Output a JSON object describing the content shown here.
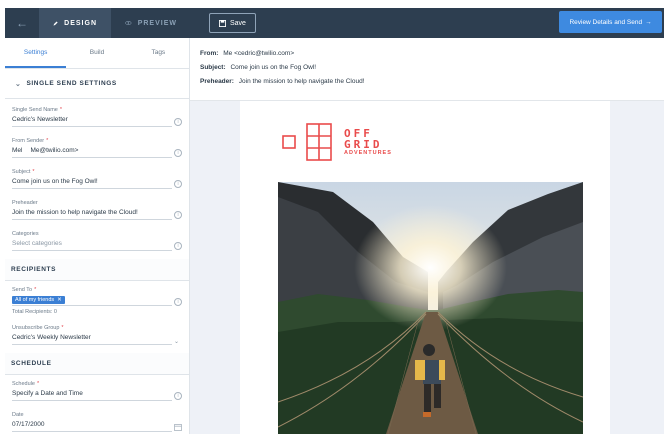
{
  "topbar": {
    "design_label": "DESIGN",
    "preview_label": "PREVIEW",
    "save_label": "Save",
    "review_label": "Review Details and Send",
    "review_arrow": "→"
  },
  "left": {
    "tabs": [
      "Settings",
      "Build",
      "Tags"
    ],
    "single_send_settings": "SINGLE SEND SETTINGS",
    "fields": {
      "name": {
        "label": "Single Send Name",
        "value": "Cedric's Newsletter"
      },
      "from": {
        "label": "From Sender",
        "value_a": "Mel",
        "value_b": "Me@twilio.com>"
      },
      "subject": {
        "label": "Subject",
        "value": "Come join us on the Fog Owl!"
      },
      "preheader": {
        "label": "Preheader",
        "value": "Join the mission to help navigate the Cloud!"
      },
      "categories": {
        "label": "Categories",
        "placeholder": "Select categories"
      }
    },
    "recipients": {
      "heading": "RECIPIENTS",
      "send_to_label": "Send To",
      "chip": "All of my friends",
      "total": "Total Recipients: 0",
      "unsub_label": "Unsubscribe Group",
      "unsub_value": "Cedric's Weekly Newsletter"
    },
    "schedule": {
      "heading": "SCHEDULE",
      "schedule_label": "Schedule",
      "schedule_value": "Specify a Date and Time",
      "date_label": "Date",
      "date_value": "07/17/2000"
    }
  },
  "preview": {
    "from_label": "From:",
    "from_value": "Me <cedric@twilio.com>",
    "subject_label": "Subject:",
    "subject_value": "Come join us on the Fog Owl!",
    "preheader_label": "Preheader:",
    "preheader_value": "Join the mission to help navigate the Cloud!",
    "logo_line1": "OFF",
    "logo_line2": "GRID",
    "logo_line3": "ADVENTURES"
  },
  "colors": {
    "topbar": "#2d3e50",
    "accent": "#3b7fd4",
    "logo": "#e94b4b"
  }
}
